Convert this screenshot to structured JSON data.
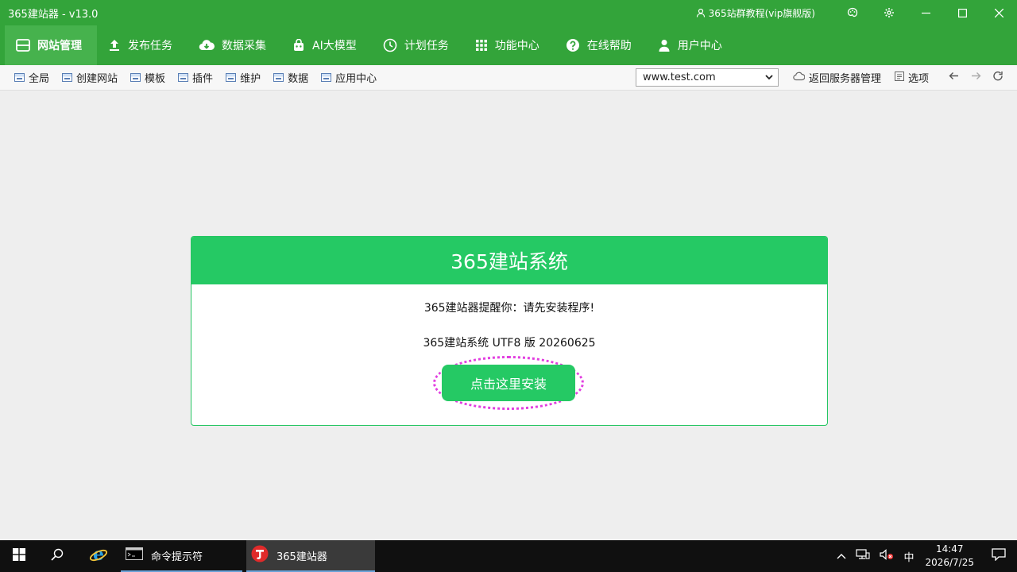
{
  "titlebar": {
    "app_title": "365建站器 - v13.0",
    "tutorial_label": "365站群教程(vip旗舰版)"
  },
  "mainnav": {
    "items": [
      {
        "label": "网站管理",
        "icon": "window-icon",
        "active": true
      },
      {
        "label": "发布任务",
        "icon": "upload-icon"
      },
      {
        "label": "数据采集",
        "icon": "cloud-download-icon"
      },
      {
        "label": "AI大模型",
        "icon": "robot-icon"
      },
      {
        "label": "计划任务",
        "icon": "clock-icon"
      },
      {
        "label": "功能中心",
        "icon": "grid-icon"
      },
      {
        "label": "在线帮助",
        "icon": "help-icon"
      },
      {
        "label": "用户中心",
        "icon": "user-icon"
      }
    ]
  },
  "toolbar": {
    "items": [
      "全局",
      "创建网站",
      "模板",
      "插件",
      "维护",
      "数据",
      "应用中心"
    ],
    "site_select": "www.test.com",
    "back_to_server": "返回服务器管理",
    "options": "选项"
  },
  "card": {
    "title": "365建站系统",
    "reminder": "365建站器提醒你：请先安装程序!",
    "version": "365建站系统 UTF8 版 20260625",
    "install_button": "点击这里安装"
  },
  "taskbar": {
    "apps": [
      {
        "label": "命令提示符"
      },
      {
        "label": "365建站器"
      }
    ],
    "ime": "中",
    "time": "14:47",
    "date": "2026/7/25"
  },
  "colors": {
    "titlebar": "#33a43a",
    "card_header": "#25c964",
    "dotted_highlight": "#e23ee0"
  }
}
